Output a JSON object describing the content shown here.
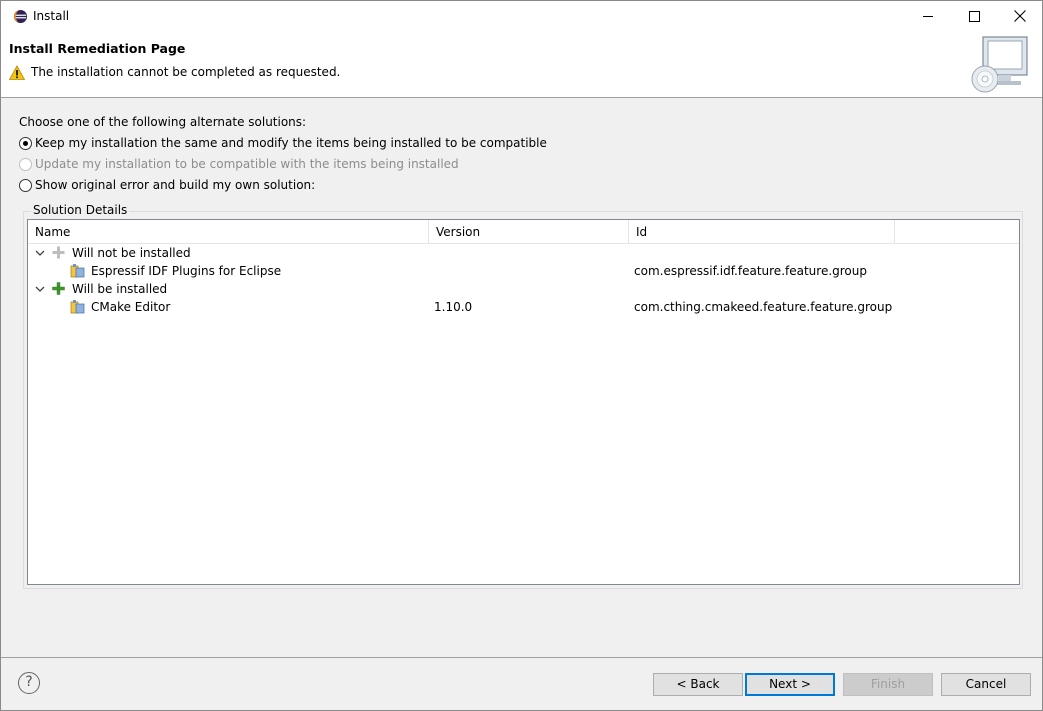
{
  "window": {
    "title": "Install"
  },
  "banner": {
    "title": "Install Remediation Page",
    "message": "The installation cannot be completed as requested."
  },
  "options": {
    "prompt": "Choose one of the following alternate solutions:",
    "items": [
      {
        "label": "Keep my installation the same and modify the items being installed to be compatible",
        "checked": true,
        "enabled": true
      },
      {
        "label": "Update my installation to be compatible with the items being installed",
        "checked": false,
        "enabled": false
      },
      {
        "label": "Show original error and build my own solution:",
        "checked": false,
        "enabled": true
      }
    ]
  },
  "details": {
    "legend": "Solution Details",
    "columns": [
      "Name",
      "Version",
      "Id"
    ],
    "groups": [
      {
        "label": "Will not be installed",
        "items": [
          {
            "name": "Espressif IDF Plugins for Eclipse",
            "version": "",
            "id": "com.espressif.idf.feature.feature.group"
          }
        ]
      },
      {
        "label": "Will be installed",
        "items": [
          {
            "name": "CMake Editor",
            "version": "1.10.0",
            "id": "com.cthing.cmakeed.feature.feature.group"
          }
        ]
      }
    ]
  },
  "footer": {
    "help": "?",
    "back": "< Back",
    "next": "Next >",
    "finish": "Finish",
    "cancel": "Cancel"
  },
  "colors": {
    "accent": "#0078d7",
    "add_green": "#3c9a2a",
    "warning": "#f2c511"
  }
}
